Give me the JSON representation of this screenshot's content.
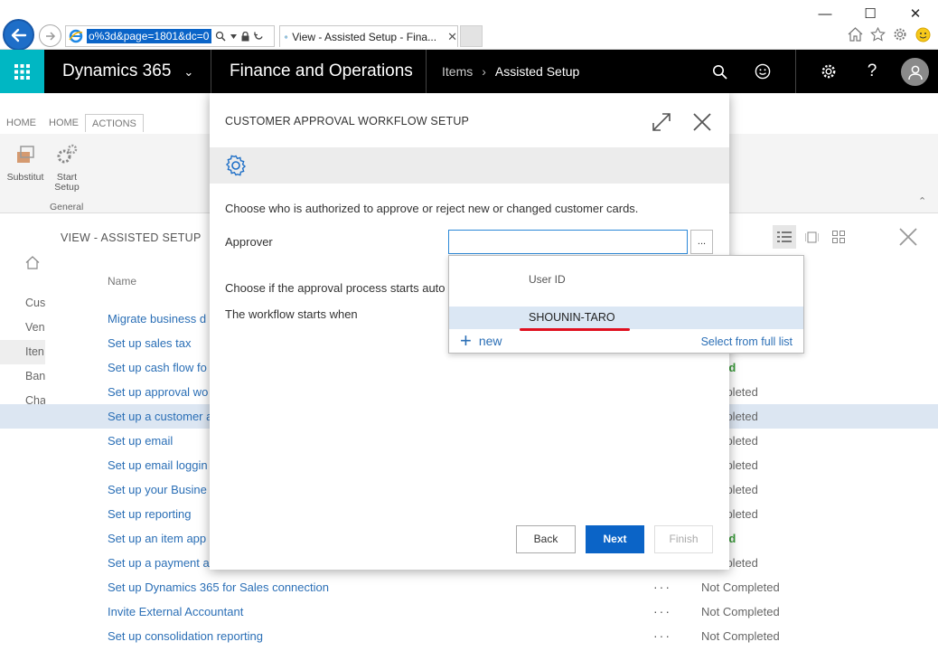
{
  "browser": {
    "url": "o%3d&page=1801&dc=0",
    "tab_title": "View - Assisted Setup - Fina...",
    "tab_close": "✕",
    "window": {
      "minimize": "—",
      "maximize": "☐",
      "close": "✕"
    }
  },
  "navbar": {
    "brand": "Dynamics 365",
    "brand_chevron": "⌄",
    "app": "Finance and Operations",
    "breadcrumb": [
      "Items",
      "Assisted Setup"
    ],
    "breadcrumb_sep": "›",
    "help": "?"
  },
  "ribbon": {
    "tabs": [
      "HOME",
      "HOME",
      "ACTIONS"
    ],
    "buttons": [
      {
        "label1": "Substitut",
        "label2": ""
      },
      {
        "label1": "Start",
        "label2": "Setup"
      }
    ],
    "group": "General"
  },
  "page": {
    "heading": "VIEW - ASSISTED SETUP",
    "left_nav": [
      "Cus",
      "Ven",
      "Iten",
      "Ban",
      "Cha"
    ],
    "column_name": "Name",
    "rows": [
      {
        "name": "Migrate business d",
        "dots": "",
        "status": "",
        "status_style": ""
      },
      {
        "name": "Set up sales tax",
        "dots": "",
        "status": "",
        "status_style": ""
      },
      {
        "name": "Set up cash flow fo",
        "dots": "",
        "status": "pleted",
        "status_style": "green"
      },
      {
        "name": "Set up approval wo",
        "dots": "",
        "status": "Completed",
        "status_style": ""
      },
      {
        "name": "Set up a customer a",
        "dots": "",
        "status": "Completed",
        "status_style": ""
      },
      {
        "name": "Set up email",
        "dots": "",
        "status": "Completed",
        "status_style": ""
      },
      {
        "name": "Set up email loggin",
        "dots": "",
        "status": "Completed",
        "status_style": ""
      },
      {
        "name": "Set up your Busine",
        "dots": "",
        "status": "Completed",
        "status_style": ""
      },
      {
        "name": "Set up reporting",
        "dots": "",
        "status": "Completed",
        "status_style": ""
      },
      {
        "name": "Set up an item app",
        "dots": "",
        "status": "pleted",
        "status_style": "green"
      },
      {
        "name": "Set up a payment a",
        "dots": "",
        "status": "Completed",
        "status_style": ""
      },
      {
        "name": "Set up Dynamics 365 for Sales connection",
        "dots": "···",
        "status": "Not Completed",
        "status_style": ""
      },
      {
        "name": "Invite External Accountant",
        "dots": "···",
        "status": "Not Completed",
        "status_style": ""
      },
      {
        "name": "Set up consolidation reporting",
        "dots": "···",
        "status": "Not Completed",
        "status_style": ""
      }
    ]
  },
  "dialog": {
    "title": "CUSTOMER APPROVAL WORKFLOW SETUP",
    "description": "Choose who is authorized to approve or reject new or changed customer cards.",
    "approver_label": "Approver",
    "approver_value": "",
    "lookup_label": "...",
    "choose_text": "Choose if the approval process starts auto",
    "workflow_starts": "The workflow starts when",
    "back": "Back",
    "next": "Next",
    "finish": "Finish"
  },
  "lookup": {
    "header": "User ID",
    "selected": "SHOUNIN-TARO",
    "new_label": "new",
    "full_list": "Select from full list"
  },
  "colors": {
    "accent": "#0b64c7",
    "waffle": "#00b7c3",
    "link": "#2b6fb6",
    "annotation": "#e0101f"
  }
}
